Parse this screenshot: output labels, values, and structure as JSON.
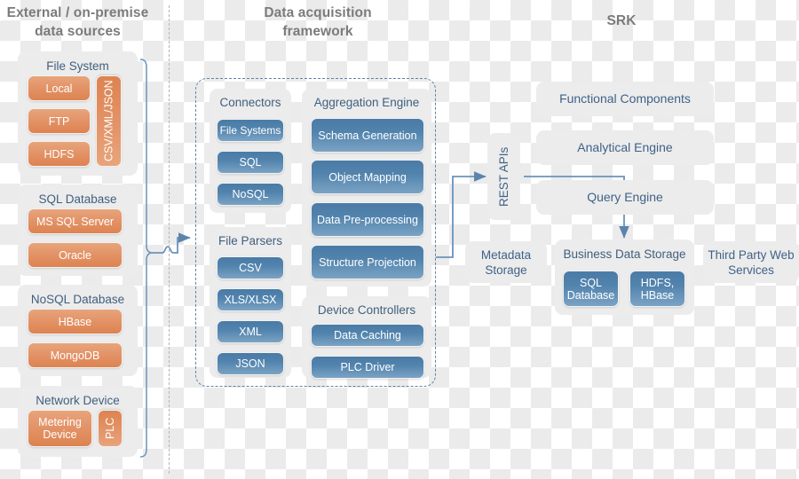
{
  "headers": {
    "left": "External / on-premise\ndata sources",
    "left_line1": "External / on-premise",
    "left_line2": "data sources",
    "center_line1": "Data acquisition",
    "center_line2": "framework",
    "right": "SRK"
  },
  "colors": {
    "orange": "#e08c5c",
    "blue": "#5183ad",
    "panel_grey": "#ececec",
    "header_grey": "#7b7b7b",
    "title_blue": "#3f5f7d",
    "line_blue": "#5b84ad",
    "divider_grey": "#b4b4b4",
    "checker_grey": "#ebebeb"
  },
  "left_column": {
    "groups": [
      {
        "title": "File System",
        "items": [
          "Local",
          "FTP",
          "HDFS"
        ],
        "side_item": "CSV/XML/JSON"
      },
      {
        "title": "SQL Database",
        "items": [
          "MS SQL Server",
          "Oracle"
        ]
      },
      {
        "title": "NoSQL Database",
        "items": [
          "HBase",
          "MongoDB"
        ]
      },
      {
        "title": "Network Device",
        "items": [
          "Metering Device"
        ],
        "side_item": "PLC"
      }
    ]
  },
  "framework": {
    "groups": [
      {
        "title": "Connectors",
        "items": [
          "File Systems",
          "SQL",
          "NoSQL"
        ]
      },
      {
        "title": "File Parsers",
        "items": [
          "CSV",
          "XLS/XLSX",
          "XML",
          "JSON"
        ]
      },
      {
        "title": "Aggregation Engine",
        "items": [
          "Schema Generation",
          "Object Mapping",
          "Data Pre-processing",
          "Structure Projection"
        ]
      },
      {
        "title": "Device Controllers",
        "items": [
          "Data Caching",
          "PLC Driver"
        ]
      }
    ]
  },
  "srk": {
    "rest_apis": "REST APIs",
    "boxes": [
      "Functional Components",
      "Analytical Engine",
      "Query Engine"
    ],
    "metadata_storage": "Metadata Storage",
    "business_data_storage": {
      "title": "Business Data Storage",
      "items": [
        "SQL Database",
        "HDFS, HBase"
      ]
    },
    "third_party": "Third Party Web Services"
  }
}
